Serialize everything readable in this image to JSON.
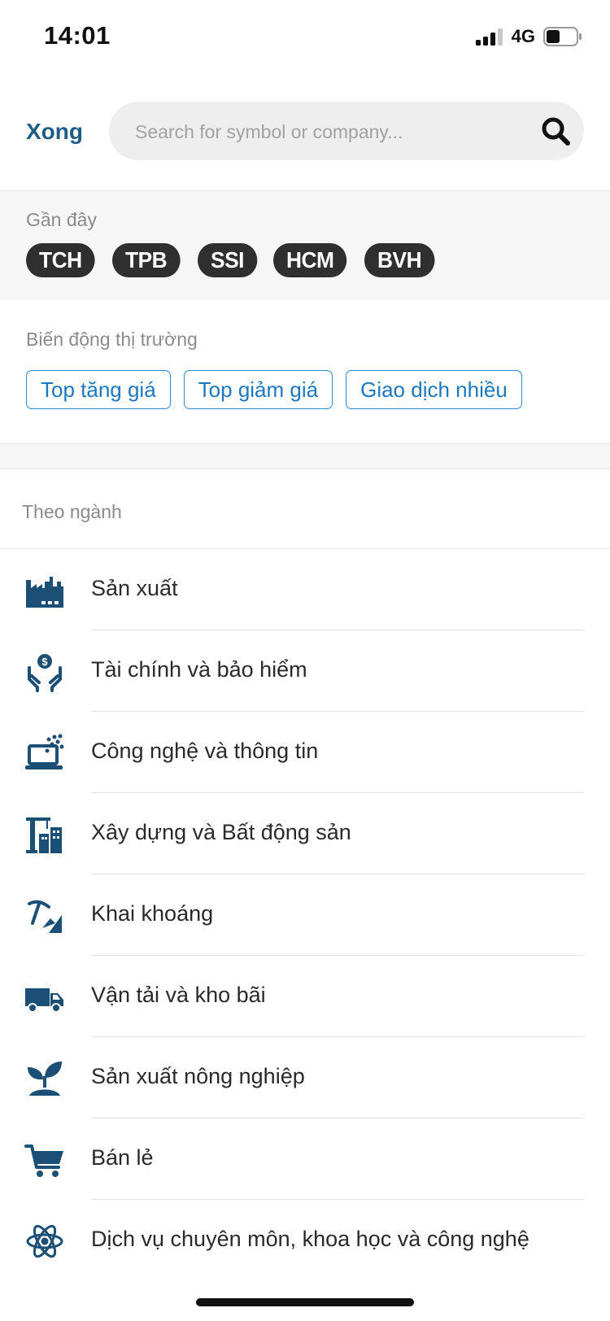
{
  "status_bar": {
    "time": "14:01",
    "network": "4G",
    "battery_percent": 40
  },
  "header": {
    "done_label": "Xong",
    "search": {
      "placeholder": "Search for symbol or company...",
      "value": "",
      "icon": "search-icon"
    }
  },
  "recent": {
    "label": "Gần đây",
    "chips": [
      "TCH",
      "TPB",
      "SSI",
      "HCM",
      "BVH"
    ]
  },
  "market": {
    "label": "Biến động thị trường",
    "buttons": [
      "Top tăng giá",
      "Top giảm giá",
      "Giao dịch nhiều"
    ]
  },
  "industry": {
    "label": "Theo ngành",
    "items": [
      {
        "label": "Sản xuất",
        "icon": "factory-icon"
      },
      {
        "label": "Tài chính và bảo hiểm",
        "icon": "finance-hands-icon"
      },
      {
        "label": "Công nghệ và thông tin",
        "icon": "laptop-tech-icon"
      },
      {
        "label": "Xây dựng và Bất động sản",
        "icon": "construction-crane-icon"
      },
      {
        "label": "Khai khoáng",
        "icon": "mining-pickaxe-icon"
      },
      {
        "label": "Vận tải và kho bãi",
        "icon": "truck-icon"
      },
      {
        "label": "Sản xuất nông nghiệp",
        "icon": "plant-sprout-icon"
      },
      {
        "label": "Bán lẻ",
        "icon": "shopping-cart-icon"
      },
      {
        "label": "Dịch vụ chuyên môn, khoa học và công nghệ",
        "icon": "atom-icon"
      }
    ]
  },
  "colors": {
    "accent_blue": "#1f5d87",
    "button_border": "#2b8bd1",
    "icon_blue": "#1b4f76",
    "chip_bg": "#2f2f2f"
  }
}
